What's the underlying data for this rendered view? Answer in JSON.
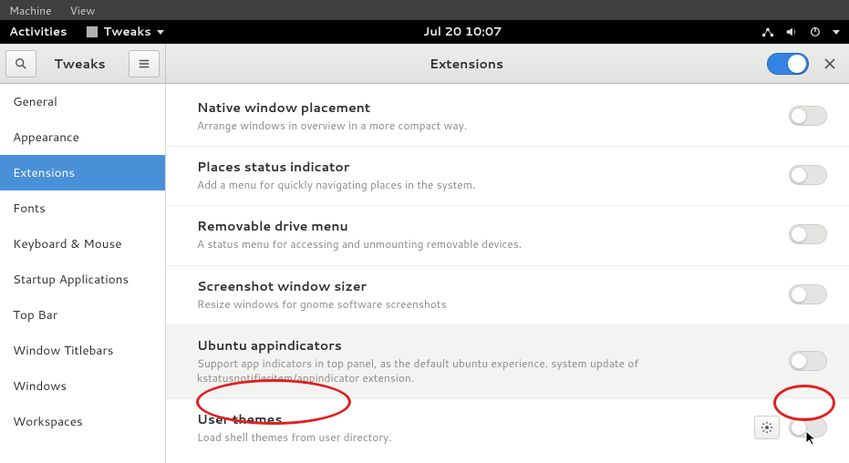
{
  "vm_menu": {
    "machine": "Machine",
    "view": "View"
  },
  "panel": {
    "activities": "Activities",
    "app_name": "Tweaks",
    "clock": "Jul 20  10:07"
  },
  "header": {
    "left_title": "Tweaks",
    "center_title": "Extensions"
  },
  "sidebar": {
    "items": [
      {
        "label": "General"
      },
      {
        "label": "Appearance"
      },
      {
        "label": "Extensions"
      },
      {
        "label": "Fonts"
      },
      {
        "label": "Keyboard & Mouse"
      },
      {
        "label": "Startup Applications"
      },
      {
        "label": "Top Bar"
      },
      {
        "label": "Window Titlebars"
      },
      {
        "label": "Windows"
      },
      {
        "label": "Workspaces"
      }
    ],
    "active_index": 2
  },
  "extensions": [
    {
      "title": "Native window placement",
      "desc": "Arrange windows in overview in a more compact way.",
      "enabled": false,
      "has_settings": false,
      "highlighted": false
    },
    {
      "title": "Places status indicator",
      "desc": "Add a menu for quickly navigating places in the system.",
      "enabled": false,
      "has_settings": false,
      "highlighted": false
    },
    {
      "title": "Removable drive menu",
      "desc": "A status menu for accessing and unmounting removable devices.",
      "enabled": false,
      "has_settings": false,
      "highlighted": false
    },
    {
      "title": "Screenshot window sizer",
      "desc": "Resize windows for gnome software screenshots",
      "enabled": false,
      "has_settings": false,
      "highlighted": false
    },
    {
      "title": "Ubuntu appindicators",
      "desc": "Support app indicators in top panel, as the default ubuntu experience. system update of kstatusnotifieritem/appindicator extension.",
      "enabled": false,
      "has_settings": false,
      "highlighted": true
    },
    {
      "title": "User themes",
      "desc": "Load shell themes from user directory.",
      "enabled": false,
      "has_settings": true,
      "highlighted": false
    }
  ]
}
